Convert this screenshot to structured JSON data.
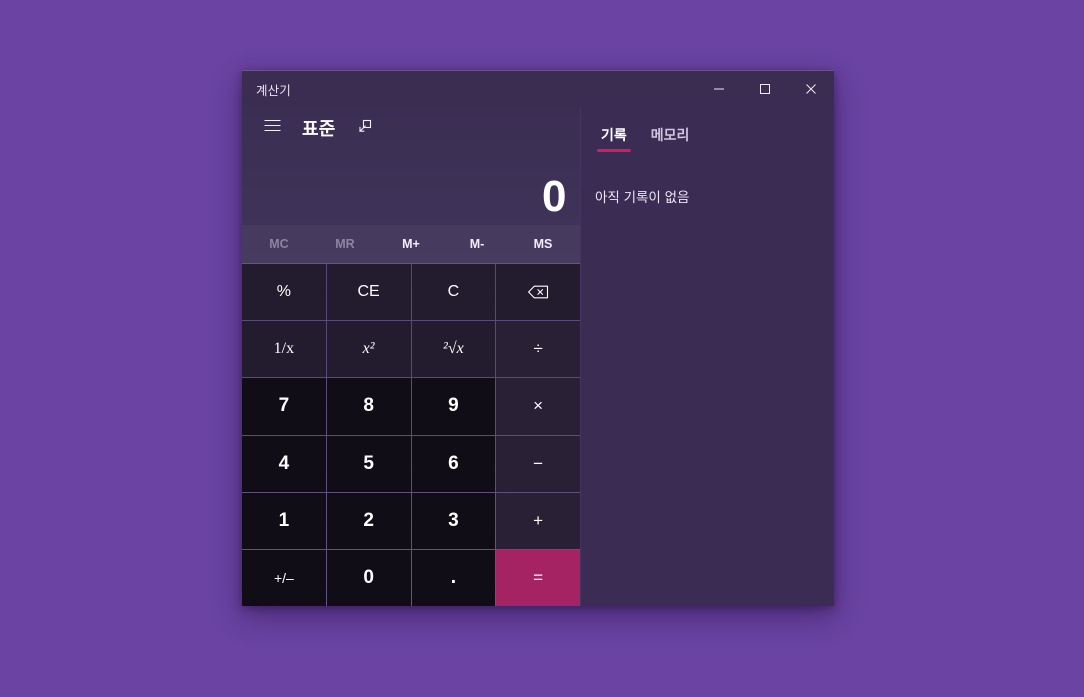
{
  "desktop": {
    "background_color": "#6a43a3"
  },
  "window": {
    "title": "계산기",
    "controls": {
      "minimize": "minimize-icon",
      "maximize": "maximize-icon",
      "close": "close-icon"
    }
  },
  "nav": {
    "menu_icon": "hamburger-menu-icon",
    "mode_title": "표준",
    "keep_on_top_icon": "keep-on-top-icon"
  },
  "display": {
    "value": "0"
  },
  "memory": {
    "buttons": [
      {
        "label": "MC",
        "enabled": false
      },
      {
        "label": "MR",
        "enabled": false
      },
      {
        "label": "M+",
        "enabled": true
      },
      {
        "label": "M-",
        "enabled": true
      },
      {
        "label": "MS",
        "enabled": true
      }
    ]
  },
  "keypad": {
    "rows": [
      [
        {
          "label": "%",
          "kind": "fn"
        },
        {
          "label": "CE",
          "kind": "fn"
        },
        {
          "label": "C",
          "kind": "fn"
        },
        {
          "label": "",
          "kind": "fn",
          "icon": "backspace-icon"
        }
      ],
      [
        {
          "label": "1/x",
          "kind": "fn"
        },
        {
          "label": "x²",
          "kind": "fn"
        },
        {
          "label": "²√x",
          "kind": "fn"
        },
        {
          "label": "÷",
          "kind": "op"
        }
      ],
      [
        {
          "label": "7",
          "kind": "num"
        },
        {
          "label": "8",
          "kind": "num"
        },
        {
          "label": "9",
          "kind": "num"
        },
        {
          "label": "×",
          "kind": "op"
        }
      ],
      [
        {
          "label": "4",
          "kind": "num"
        },
        {
          "label": "5",
          "kind": "num"
        },
        {
          "label": "6",
          "kind": "num"
        },
        {
          "label": "−",
          "kind": "op"
        }
      ],
      [
        {
          "label": "1",
          "kind": "num"
        },
        {
          "label": "2",
          "kind": "num"
        },
        {
          "label": "3",
          "kind": "num"
        },
        {
          "label": "+",
          "kind": "op"
        }
      ],
      [
        {
          "label": "+/–",
          "kind": "sign"
        },
        {
          "label": "0",
          "kind": "num"
        },
        {
          "label": ".",
          "kind": "dot"
        },
        {
          "label": "=",
          "kind": "equals"
        }
      ]
    ]
  },
  "side_panel": {
    "tabs": [
      {
        "label": "기록",
        "active": true
      },
      {
        "label": "메모리",
        "active": false
      }
    ],
    "empty_message": "아직 기록이 없음"
  },
  "colors": {
    "accent": "#d81b60",
    "equals": "#a62363",
    "number_key": "#110d17",
    "function_key": "#231c2e",
    "operator_key": "#2a2036",
    "side_panel": "#3b2c54",
    "desktop": "#6a43a3"
  }
}
